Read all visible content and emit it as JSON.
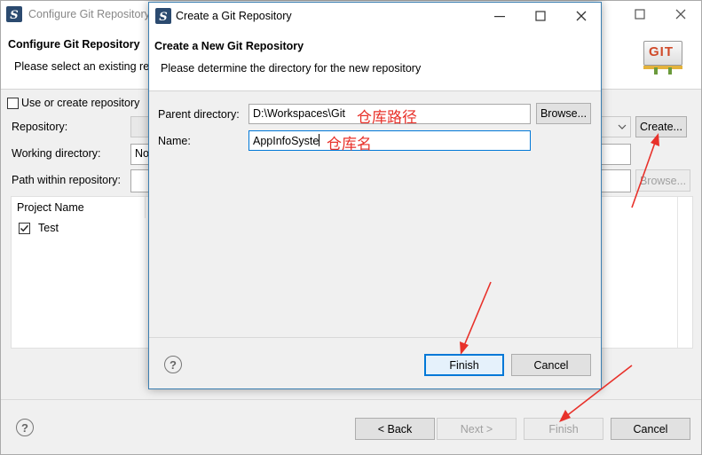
{
  "bg_window": {
    "title": "Configure Git Repository",
    "header_title": "Configure Git Repository",
    "header_desc": "Please select an existing re",
    "use_create_checkbox": "Use or create repository",
    "repository_label": "Repository:",
    "working_dir_label": "Working directory:",
    "working_dir_value": "No",
    "path_label": "Path within repository:",
    "create_button": "Create...",
    "browse_button": "Browse...",
    "table_header": "Project Name",
    "table_rows": [
      {
        "name": "Test",
        "checked": true
      }
    ],
    "back_button": "< Back",
    "next_button": "Next >",
    "finish_button": "Finish",
    "cancel_button": "Cancel",
    "git_logo": "GIT"
  },
  "dialog": {
    "title": "Create a Git Repository",
    "header_title": "Create a New Git Repository",
    "header_desc": "Please determine the directory for the new repository",
    "parent_dir_label": "Parent directory:",
    "parent_dir_value": "D:\\Workspaces\\Git",
    "browse_button": "Browse...",
    "name_label": "Name:",
    "name_value": "AppInfoSyste",
    "finish_button": "Finish",
    "cancel_button": "Cancel"
  },
  "annotations": {
    "parent_dir_note": "仓库路径",
    "name_note": "仓库名"
  },
  "colors": {
    "annotation": "#e8312a",
    "focus_border": "#0078d7",
    "title_bar_bg": "#ffffff"
  }
}
